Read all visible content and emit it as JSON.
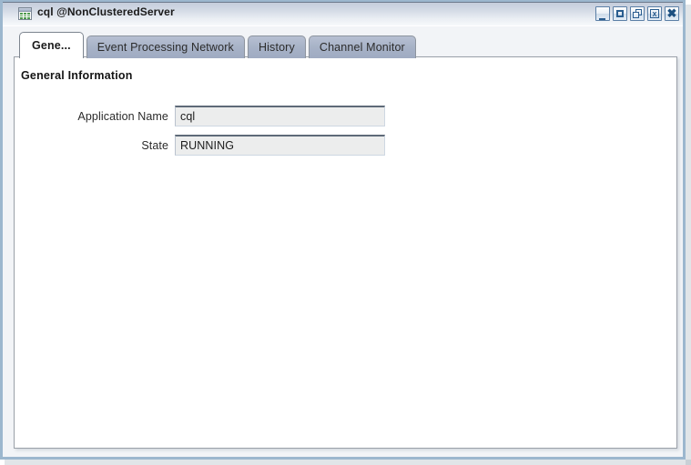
{
  "window": {
    "title": "cql @NonClusteredServer",
    "icon": "table-grid-icon",
    "controls": [
      {
        "name": "minimize-button",
        "label": "Minimize",
        "glyph": "minimize"
      },
      {
        "name": "maximize-button",
        "label": "Maximize",
        "glyph": "maximize"
      },
      {
        "name": "restore-button",
        "label": "Restore",
        "glyph": "restore"
      },
      {
        "name": "close-document-button",
        "label": "x",
        "glyph": "close-doc"
      },
      {
        "name": "close-button",
        "label": "✖",
        "glyph": "close"
      }
    ]
  },
  "tabs": [
    {
      "label": "Gene...",
      "name": "tab-general",
      "active": true
    },
    {
      "label": "Event Processing Network",
      "name": "tab-event-processing-network",
      "active": false
    },
    {
      "label": "History",
      "name": "tab-history",
      "active": false
    },
    {
      "label": "Channel Monitor",
      "name": "tab-channel-monitor",
      "active": false
    }
  ],
  "general": {
    "section_title": "General Information",
    "fields": [
      {
        "label": "Application Name",
        "value": "cql",
        "name": "application-name"
      },
      {
        "label": "State",
        "value": "RUNNING",
        "name": "state"
      }
    ]
  },
  "colors": {
    "window_border": "#9cb7ce",
    "titlebar_top": "#c3cbda",
    "tab_inactive": "#a7b2c7",
    "tab_active": "#ffffff",
    "field_bg": "#eceded",
    "panel_bg": "#ffffff"
  }
}
